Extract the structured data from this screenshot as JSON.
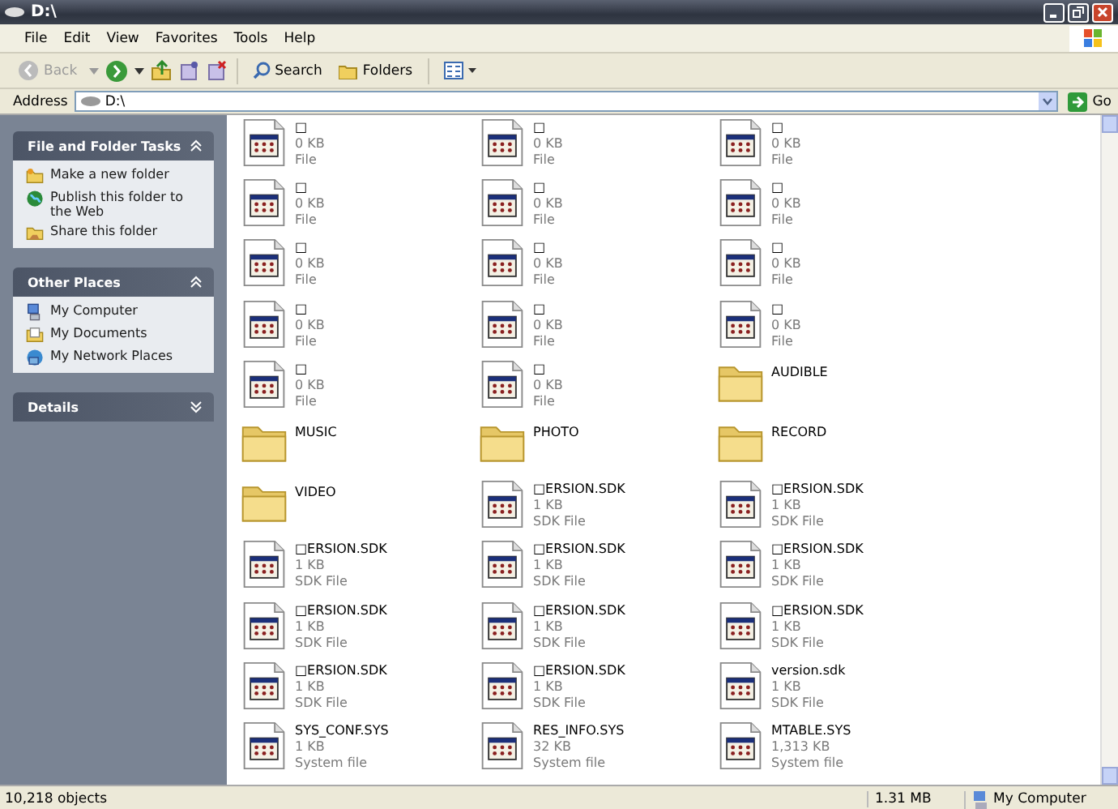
{
  "window": {
    "title": "D:\\"
  },
  "menu": [
    "File",
    "Edit",
    "View",
    "Favorites",
    "Tools",
    "Help"
  ],
  "toolbar": {
    "back": {
      "label": "Back",
      "disabled": true
    },
    "search": "Search",
    "folders": "Folders"
  },
  "address": {
    "label": "Address",
    "value": "D:\\",
    "go": "Go"
  },
  "sidebar": [
    {
      "title": "File and Folder Tasks",
      "expanded": true,
      "items": [
        {
          "label": "Make a new folder",
          "kind": "newfolder"
        },
        {
          "label": "Publish this folder to the Web",
          "kind": "web"
        },
        {
          "label": "Share this folder",
          "kind": "share"
        }
      ]
    },
    {
      "title": "Other Places",
      "expanded": true,
      "items": [
        {
          "label": "My Computer",
          "kind": "computer"
        },
        {
          "label": "My Documents",
          "kind": "documents"
        },
        {
          "label": "My Network Places",
          "kind": "network"
        }
      ]
    },
    {
      "title": "Details",
      "expanded": false
    }
  ],
  "files": [
    {
      "kind": "file",
      "name": "□",
      "size": "0 KB",
      "type": "File"
    },
    {
      "kind": "file",
      "name": "□",
      "size": "0 KB",
      "type": "File"
    },
    {
      "kind": "file",
      "name": "□",
      "size": "0 KB",
      "type": "File"
    },
    {
      "kind": "file",
      "name": "□",
      "size": "0 KB",
      "type": "File"
    },
    {
      "kind": "file",
      "name": "□",
      "size": "0 KB",
      "type": "File"
    },
    {
      "kind": "file",
      "name": "□",
      "size": "0 KB",
      "type": "File"
    },
    {
      "kind": "file",
      "name": "□",
      "size": "0 KB",
      "type": "File"
    },
    {
      "kind": "file",
      "name": "□",
      "size": "0 KB",
      "type": "File"
    },
    {
      "kind": "file",
      "name": "□",
      "size": "0 KB",
      "type": "File"
    },
    {
      "kind": "file",
      "name": "□",
      "size": "0 KB",
      "type": "File"
    },
    {
      "kind": "file",
      "name": "□",
      "size": "0 KB",
      "type": "File"
    },
    {
      "kind": "file",
      "name": "□",
      "size": "0 KB",
      "type": "File"
    },
    {
      "kind": "file",
      "name": "□",
      "size": "0 KB",
      "type": "File"
    },
    {
      "kind": "file",
      "name": "□",
      "size": "0 KB",
      "type": "File"
    },
    {
      "kind": "folder",
      "name": "AUDIBLE"
    },
    {
      "kind": "folder",
      "name": "MUSIC"
    },
    {
      "kind": "folder",
      "name": "PHOTO"
    },
    {
      "kind": "folder",
      "name": "RECORD"
    },
    {
      "kind": "folder",
      "name": "VIDEO"
    },
    {
      "kind": "file",
      "name": "□ERSION.SDK",
      "size": "1 KB",
      "type": "SDK File"
    },
    {
      "kind": "file",
      "name": "□ERSION.SDK",
      "size": "1 KB",
      "type": "SDK File"
    },
    {
      "kind": "file",
      "name": "□ERSION.SDK",
      "size": "1 KB",
      "type": "SDK File"
    },
    {
      "kind": "file",
      "name": "□ERSION.SDK",
      "size": "1 KB",
      "type": "SDK File"
    },
    {
      "kind": "file",
      "name": "□ERSION.SDK",
      "size": "1 KB",
      "type": "SDK File"
    },
    {
      "kind": "file",
      "name": "□ERSION.SDK",
      "size": "1 KB",
      "type": "SDK File"
    },
    {
      "kind": "file",
      "name": "□ERSION.SDK",
      "size": "1 KB",
      "type": "SDK File"
    },
    {
      "kind": "file",
      "name": "□ERSION.SDK",
      "size": "1 KB",
      "type": "SDK File"
    },
    {
      "kind": "file",
      "name": "□ERSION.SDK",
      "size": "1 KB",
      "type": "SDK File"
    },
    {
      "kind": "file",
      "name": "□ERSION.SDK",
      "size": "1 KB",
      "type": "SDK File"
    },
    {
      "kind": "file",
      "name": "version.sdk",
      "size": "1 KB",
      "type": "SDK File"
    },
    {
      "kind": "file",
      "name": "SYS_CONF.SYS",
      "size": "1 KB",
      "type": "System file"
    },
    {
      "kind": "file",
      "name": "RES_INFO.SYS",
      "size": "32 KB",
      "type": "System file"
    },
    {
      "kind": "file",
      "name": "MTABLE.SYS",
      "size": "1,313 KB",
      "type": "System file"
    }
  ],
  "status_bar": {
    "objects": "10,218 objects",
    "size": "1.31 MB",
    "location": "My Computer"
  }
}
